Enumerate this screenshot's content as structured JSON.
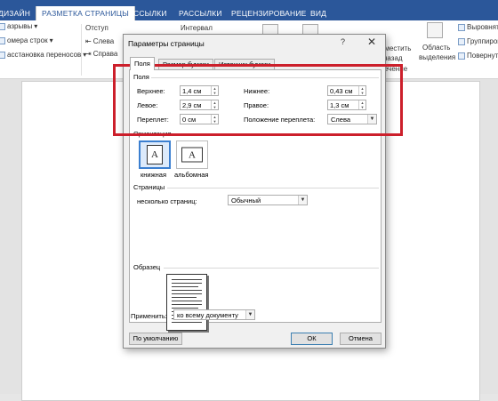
{
  "ribbon": {
    "tabs": [
      "ДИЗАЙН",
      "РАЗМЕТКА СТРАНИЦЫ",
      "ССЫЛКИ",
      "РАССЫЛКИ",
      "РЕЦЕНЗИРОВАНИЕ",
      "ВИД"
    ],
    "active_tab": "РАЗМЕТКА СТРАНИЦЫ",
    "left_items": [
      "азрывы",
      "омера строк",
      "асстановка переносов"
    ],
    "otstup_label": "Отступ",
    "sleva_label": "Слева",
    "sprava_label": "Справа",
    "interval_label": "Интервал",
    "oblast_label1": "Область",
    "oblast_label2": "выделения",
    "right_items": [
      "Выровнять",
      "Группиров",
      "Повернуть"
    ],
    "partial_label1": "еместить",
    "partial_label2": "назад",
    "partial_label3": "ечение"
  },
  "dialog": {
    "title": "Параметры страницы",
    "help": "?",
    "close": "✕",
    "tabs": [
      "Поля",
      "Размер бумаги",
      "Источник бумаги"
    ],
    "active_tab": "Поля",
    "fields_section": "Поля",
    "top_label": "Верхнее:",
    "top_value": "1,4 см",
    "bottom_label": "Нижнее:",
    "bottom_value": "0,43 см",
    "left_label": "Левое:",
    "left_value": "2,9 см",
    "right_label": "Правое:",
    "right_value": "1,3 см",
    "gutter_label": "Переплет:",
    "gutter_value": "0 см",
    "gutter_pos_label": "Положение переплета:",
    "gutter_pos_value": "Слева",
    "orientation_section": "Ориентация",
    "portrait_label": "книжная",
    "landscape_label": "альбомная",
    "orientation_icon_letter": "A",
    "pages_section": "Страницы",
    "multiple_pages_label": "несколько страниц:",
    "multiple_pages_value": "Обычный",
    "preview_section": "Образец",
    "apply_label": "Применить:",
    "apply_value": "ко всему документу",
    "default_button": "По умолчанию",
    "ok_button": "ОК",
    "cancel_button": "Отмена"
  },
  "colors": {
    "ribbon_blue": "#2b579a",
    "highlight_red": "#cc1f2b",
    "selected_blue": "#3b7fd0"
  }
}
